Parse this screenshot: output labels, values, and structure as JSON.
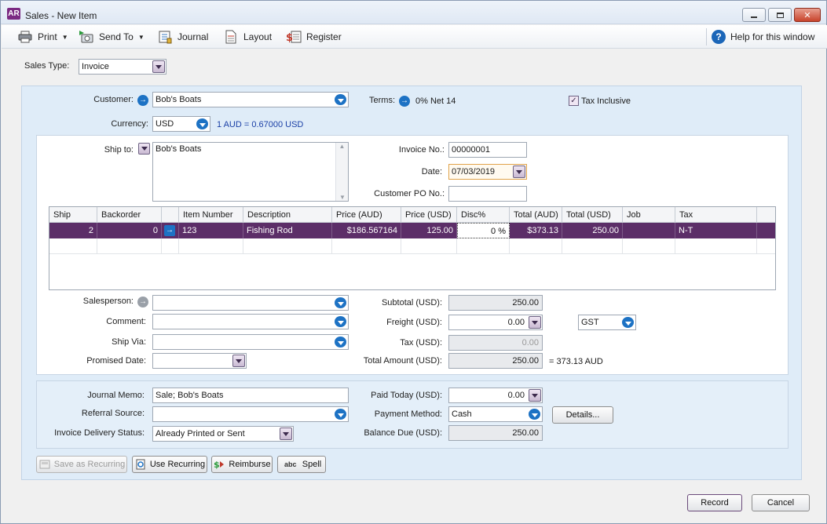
{
  "window": {
    "app_logo": "AR",
    "title": "Sales - New Item"
  },
  "toolbar": {
    "print": "Print",
    "send_to": "Send To",
    "journal": "Journal",
    "layout": "Layout",
    "register": "Register",
    "help": "Help for this window"
  },
  "sales_type": {
    "label": "Sales Type:",
    "value": "Invoice"
  },
  "customer": {
    "label": "Customer:",
    "value": "Bob's Boats"
  },
  "terms": {
    "label": "Terms:",
    "value": "0% Net 14"
  },
  "tax_inclusive": {
    "label": "Tax Inclusive",
    "checked": true,
    "mark": "✓"
  },
  "currency": {
    "label": "Currency:",
    "value": "USD",
    "rate": "1 AUD = 0.67000 USD"
  },
  "ship_to": {
    "label": "Ship to:",
    "value": "Bob's Boats"
  },
  "invoice_no": {
    "label": "Invoice No.:",
    "value": "00000001"
  },
  "date": {
    "label": "Date:",
    "value": "07/03/2019"
  },
  "customer_po": {
    "label": "Customer PO No.:",
    "value": ""
  },
  "grid": {
    "columns": [
      "Ship",
      "Backorder",
      "",
      "Item Number",
      "Description",
      "Price (AUD)",
      "Price (USD)",
      "Disc%",
      "Total (AUD)",
      "Total (USD)",
      "Job",
      "Tax"
    ],
    "rows": [
      {
        "ship": "2",
        "backorder": "0",
        "item_number": "123",
        "description": "Fishing Rod",
        "price_aud": "$186.567164",
        "price_usd": "125.00",
        "disc": "0 %",
        "total_aud": "$373.13",
        "total_usd": "250.00",
        "job": "",
        "tax": "N-T"
      }
    ]
  },
  "salesperson": {
    "label": "Salesperson:",
    "value": ""
  },
  "comment": {
    "label": "Comment:",
    "value": ""
  },
  "ship_via": {
    "label": "Ship Via:",
    "value": ""
  },
  "promised_date": {
    "label": "Promised Date:",
    "value": ""
  },
  "subtotal": {
    "label": "Subtotal (USD):",
    "value": "250.00"
  },
  "freight": {
    "label": "Freight (USD):",
    "value": "0.00",
    "tax_code": "GST"
  },
  "tax": {
    "label": "Tax (USD):",
    "value": "0.00"
  },
  "total_amount": {
    "label": "Total Amount (USD):",
    "value": "250.00",
    "converted": "= 373.13 AUD"
  },
  "journal_memo": {
    "label": "Journal Memo:",
    "value": "Sale; Bob's Boats"
  },
  "referral_source": {
    "label": "Referral Source:",
    "value": ""
  },
  "delivery_status": {
    "label": "Invoice Delivery Status:",
    "value": "Already Printed or Sent"
  },
  "paid_today": {
    "label": "Paid Today (USD):",
    "value": "0.00"
  },
  "payment_method": {
    "label": "Payment Method:",
    "value": "Cash"
  },
  "balance_due": {
    "label": "Balance Due (USD):",
    "value": "250.00"
  },
  "buttons": {
    "details": "Details...",
    "save_recurring": "Save as Recurring",
    "use_recurring": "Use Recurring",
    "reimburse": "Reimburse",
    "spell": "Spell",
    "record": "Record",
    "cancel": "Cancel"
  },
  "icons": {
    "arrow": "→",
    "help": "?",
    "spell": "abc"
  },
  "colors": {
    "accent_purple": "#5c2e68",
    "link_blue": "#1d72c4",
    "panel_blue": "#dfecf8"
  }
}
